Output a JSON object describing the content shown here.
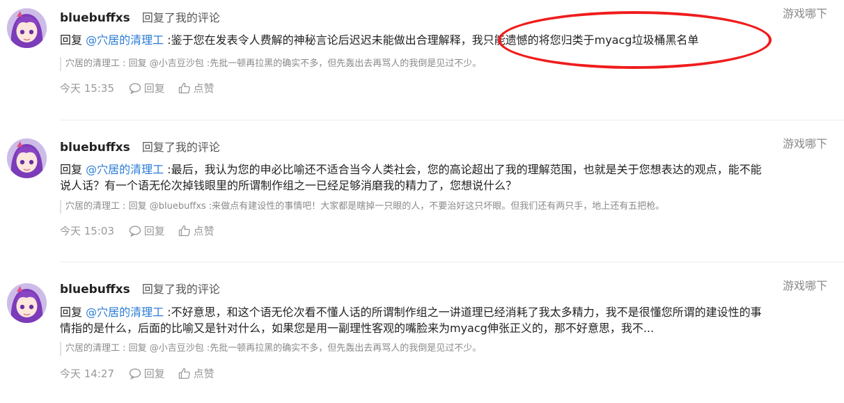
{
  "colors": {
    "mention": "#2a7bd5",
    "annotation": "#f01c1c",
    "muted": "#999999"
  },
  "icons": {
    "avatar": "avatar-image",
    "reply": "comment-bubble-icon",
    "like": "thumbs-up-icon"
  },
  "comments": [
    {
      "username": "bluebuffxs",
      "action": "回复了我的评论",
      "source": "游戏哪下",
      "reply_prefix": "回复",
      "mention": "@穴居的清理工",
      "body": ":鉴于您在发表令人费解的神秘言论后迟迟未能做出合理解释，我只能遗憾的将您归类于myacg垃圾桶黑名单",
      "quote": "穴居的清理工 : 回复 @小吉豆沙包 :先批一顿再拉黑的确实不多，但先轰出去再骂人的我倒是见过不少。",
      "time": "今天 15:35",
      "reply_label": "回复",
      "like_label": "点赞"
    },
    {
      "username": "bluebuffxs",
      "action": "回复了我的评论",
      "source": "游戏哪下",
      "reply_prefix": "回复",
      "mention": "@穴居的清理工",
      "body": ":最后，我认为您的申必比喻还不适合当今人类社会，您的高论超出了我的理解范围，也就是关于您想表达的观点，能不能说人话？有一个语无伦次掉钱眼里的所谓制作组之一已经足够消磨我的精力了，您想说什么？",
      "quote": "穴居的清理工 : 回复 @bluebuffxs :来做点有建设性的事情吧！大家都是瞎掉一只眼的人，不要治好这只坏眼。但我们还有两只手，地上还有五把枪。",
      "time": "今天 15:03",
      "reply_label": "回复",
      "like_label": "点赞"
    },
    {
      "username": "bluebuffxs",
      "action": "回复了我的评论",
      "source": "游戏哪下",
      "reply_prefix": "回复",
      "mention": "@穴居的清理工",
      "body": ":不好意思，和这个语无伦次看不懂人话的所谓制作组之一讲道理已经消耗了我太多精力，我不是很懂您所谓的建设性的事情指的是什么，后面的比喻又是针对什么，如果您是用一副理性客观的嘴脸来为myacg伸张正义的，那不好意思，我不...",
      "quote": "穴居的清理工 : 回复 @小吉豆沙包 :先批一顿再拉黑的确实不多，但先轰出去再骂人的我倒是见过不少。",
      "time": "今天 14:27",
      "reply_label": "回复",
      "like_label": "点赞"
    }
  ]
}
